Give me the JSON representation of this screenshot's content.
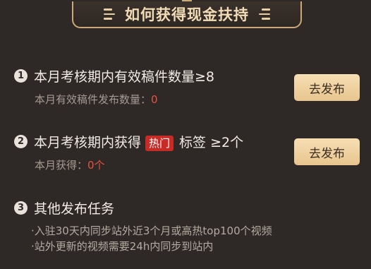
{
  "header": {
    "title": "如何获得现金扶持"
  },
  "tasks": [
    {
      "number": "1",
      "title": "本月考核期内有效稿件数量≥8",
      "sub_label": "本月有效稿件发布数量：",
      "sub_value": "0",
      "button_label": "去发布"
    },
    {
      "number": "2",
      "title_prefix": "本月考核期内获得",
      "tag": "热门",
      "title_suffix": "标签 ≥2个",
      "sub_label": "本月获得：",
      "sub_value": "0个",
      "button_label": "去发布"
    },
    {
      "number": "3",
      "title": "其他发布任务",
      "bullets": [
        "·入驻30天内同步站外近3个月或高热top100个视频",
        "·站外更新的视频需要24h内同步到站内"
      ]
    }
  ],
  "colors": {
    "background": "#2e2926",
    "accent_gold": "#caa877",
    "button_gold": "#e8c58e",
    "hot_red": "#c62b26",
    "value_red": "#e5533f"
  }
}
